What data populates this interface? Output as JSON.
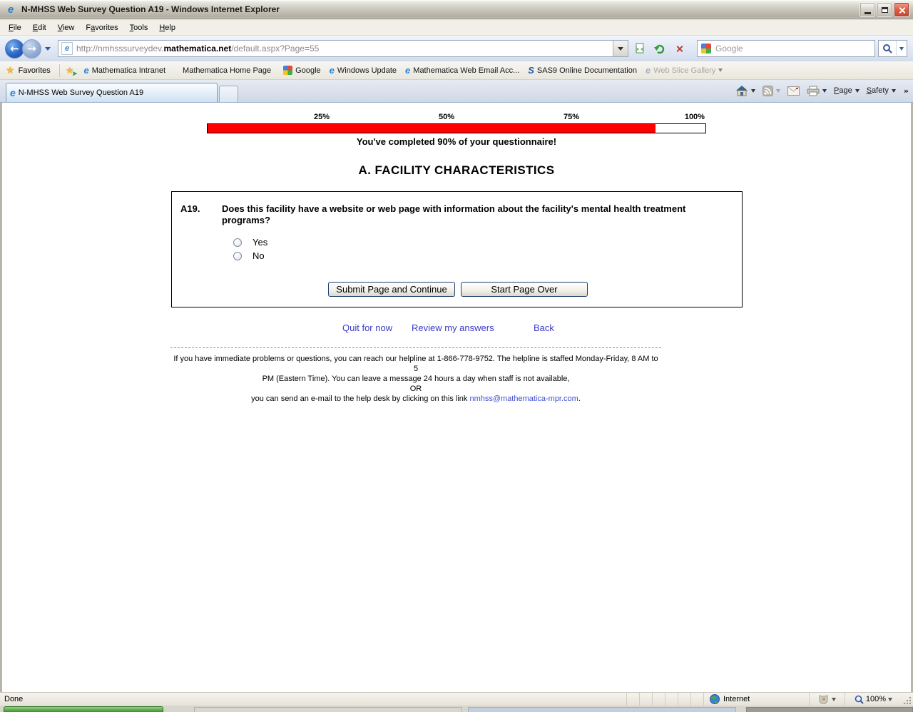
{
  "window": {
    "title": "N-MHSS Web Survey Question A19 - Windows Internet Explorer"
  },
  "menu": {
    "items": [
      {
        "pre": "",
        "accel": "F",
        "rest": "ile"
      },
      {
        "pre": "",
        "accel": "E",
        "rest": "dit"
      },
      {
        "pre": "",
        "accel": "V",
        "rest": "iew"
      },
      {
        "pre": "F",
        "accel": "a",
        "rest": "vorites"
      },
      {
        "pre": "",
        "accel": "T",
        "rest": "ools"
      },
      {
        "pre": "",
        "accel": "H",
        "rest": "elp"
      }
    ]
  },
  "nav": {
    "url_prefix": "http://nmhsssurveydev.",
    "url_host": "mathematica.net",
    "url_path": "/default.aspx?Page=55",
    "search_placeholder": "Google"
  },
  "favorites": {
    "label": "Favorites",
    "items": [
      {
        "label": "Mathematica Intranet"
      },
      {
        "label": "Mathematica Home Page"
      },
      {
        "label": "Google"
      },
      {
        "label": "Windows Update"
      },
      {
        "label": "Mathematica Web Email Acc..."
      },
      {
        "label": "SAS9 Online Documentation"
      },
      {
        "label": "Web Slice Gallery"
      }
    ]
  },
  "tab": {
    "title": "N-MHSS Web Survey Question A19"
  },
  "command_bar": {
    "page": {
      "pre": "",
      "accel": "P",
      "rest": "age"
    },
    "safety": {
      "pre": "",
      "accel": "S",
      "rest": "afety"
    },
    "chevrons": "»"
  },
  "survey": {
    "progress": {
      "ticks": [
        "25%",
        "50%",
        "75%",
        "100%"
      ],
      "percent": 90,
      "fill_color": "#ff0000",
      "message": "You've completed 90% of your questionnaire!"
    },
    "section_title": "A. FACILITY CHARACTERISTICS",
    "question": {
      "number": "A19.",
      "text": "Does this facility have a website or web page with information about the facility's mental health treatment programs?",
      "options": [
        "Yes",
        "No"
      ]
    },
    "buttons": {
      "submit": "Submit Page and Continue",
      "restart": "Start Page Over"
    },
    "links": [
      "Quit for now",
      "Review my answers",
      "Back"
    ],
    "footer": {
      "line1": "If you have immediate problems or questions, you can reach our helpline at 1-866-778-9752. The helpline is staffed Monday-Friday, 8 AM to 5",
      "line2": "PM (Eastern Time). You can leave a message 24 hours a day when staff is not available,",
      "or": "OR",
      "line3_prefix": "you can send an e-mail to the help desk by clicking on this link ",
      "email": "nmhss@mathematica-mpr.com",
      "line3_suffix": "."
    }
  },
  "status": {
    "done": "Done",
    "zone": "Internet",
    "zoom": "100%"
  }
}
